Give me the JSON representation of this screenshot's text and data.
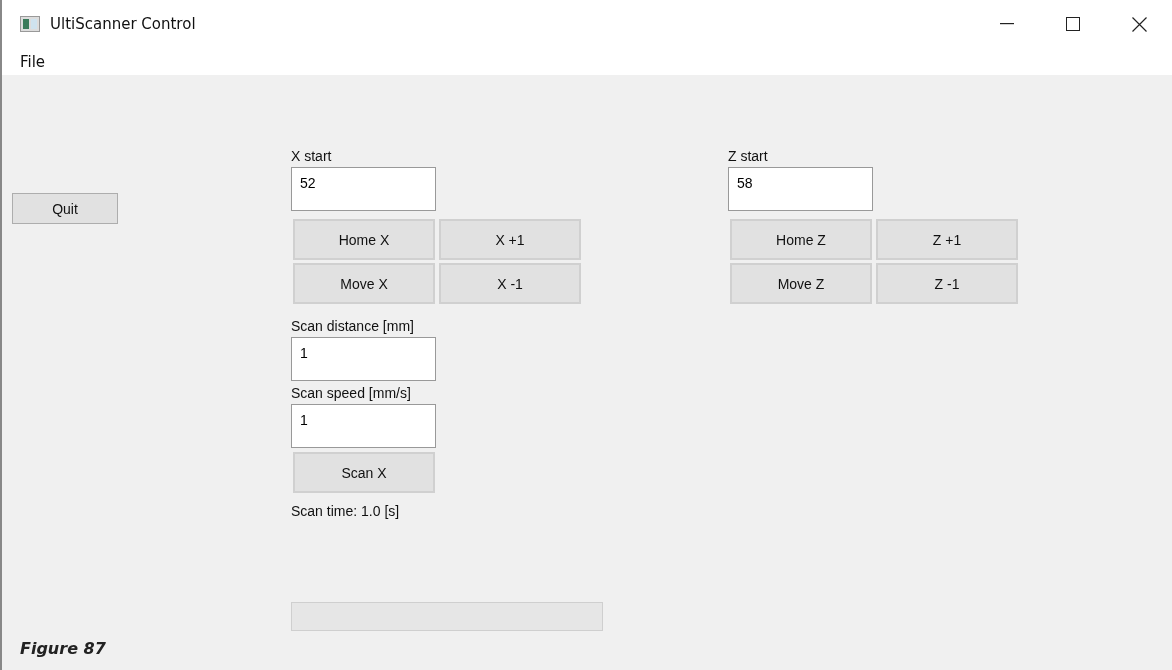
{
  "window": {
    "title": "UltiScanner Control"
  },
  "menu": [
    "File"
  ],
  "quit_button": "Quit",
  "x_axis": {
    "start_label": "X start",
    "start_value": "52",
    "buttons": [
      "Home X",
      "X +1",
      "Move X",
      "X -1"
    ]
  },
  "scan": {
    "distance_label": "Scan distance [mm]",
    "distance_value": "1",
    "speed_label": "Scan speed [mm/s]",
    "speed_value": "1",
    "button": "Scan X",
    "time": "Scan time: 1.0 [s]"
  },
  "z_axis": {
    "start_label": "Z start",
    "start_value": "58",
    "buttons": [
      "Home Z",
      "Z +1",
      "Move Z",
      "Z -1"
    ]
  },
  "progress": {
    "level": 0
  },
  "caption": "Figure 87"
}
